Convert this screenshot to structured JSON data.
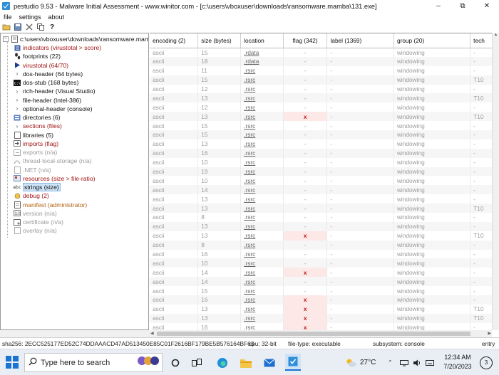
{
  "window": {
    "title": "pestudio 9.53 - Malware Initial Assessment - www.winitor.com - [c:\\users\\vboxuser\\downloads\\ransomware.mamba\\131.exe]",
    "minimize": "–",
    "maximize": "⧉",
    "close": "✕"
  },
  "menu": [
    "file",
    "settings",
    "about"
  ],
  "toolbar": [
    "open-icon",
    "save-icon",
    "close-file-icon",
    "copy-icon",
    "help-icon"
  ],
  "tree": {
    "root": "c:\\users\\vboxuser\\downloads\\ransomware.mamb",
    "items": [
      {
        "label": "indicators (virustotal > score)",
        "color": "red",
        "icon": "indicators-icon"
      },
      {
        "label": "footprints (22)",
        "color": "",
        "icon": "footprints-icon"
      },
      {
        "label": "virustotal (64/70)",
        "color": "red",
        "icon": "virustotal-icon"
      },
      {
        "label": "dos-header (64 bytes)",
        "color": "",
        "icon": "chevron-icon"
      },
      {
        "label": "dos-stub (168 bytes)",
        "color": "",
        "icon": "dos-icon"
      },
      {
        "label": "rich-header (Visual Studio)",
        "color": "",
        "icon": "chevron-icon"
      },
      {
        "label": "file-header (Intel-386)",
        "color": "",
        "icon": "chevron-icon"
      },
      {
        "label": "optional-header (console)",
        "color": "",
        "icon": "chevron-icon"
      },
      {
        "label": "directories (6)",
        "color": "",
        "icon": "directories-icon"
      },
      {
        "label": "sections (files)",
        "color": "red",
        "icon": "chevron-icon"
      },
      {
        "label": "libraries (5)",
        "color": "",
        "icon": "libraries-icon"
      },
      {
        "label": "imports (flag)",
        "color": "red",
        "icon": "imports-icon"
      },
      {
        "label": "exports (n/a)",
        "color": "grey",
        "icon": "exports-icon"
      },
      {
        "label": "thread-local-storage (n/a)",
        "color": "grey",
        "icon": "tls-icon"
      },
      {
        "label": ".NET (n/a)",
        "color": "grey",
        "icon": "dotnet-icon"
      },
      {
        "label": "resources (size > file-ratio)",
        "color": "red",
        "icon": "resources-icon"
      },
      {
        "label": "strings (size)",
        "color": "",
        "icon": "strings-icon",
        "selected": true
      },
      {
        "label": "debug (2)",
        "color": "red",
        "icon": "debug-icon"
      },
      {
        "label": "manifest (administrator)",
        "color": "orange",
        "icon": "manifest-icon"
      },
      {
        "label": "version (n/a)",
        "color": "grey",
        "icon": "version-icon"
      },
      {
        "label": "certificate (n/a)",
        "color": "grey",
        "icon": "certificate-icon"
      },
      {
        "label": "overlay (n/a)",
        "color": "grey",
        "icon": "overlay-icon"
      }
    ]
  },
  "grid": {
    "columns": [
      "encoding (2)",
      "size (bytes)",
      "location",
      "flag (342)",
      "label (1369)",
      "group (20)",
      "tech"
    ],
    "rows": [
      [
        "ascii",
        "15",
        ".rdata",
        "-",
        "-",
        "windowing",
        "-"
      ],
      [
        "ascii",
        "18",
        ".rdata",
        "-",
        "-",
        "windowing",
        "-"
      ],
      [
        "ascii",
        "11",
        ".rsrc",
        "-",
        "-",
        "windowing",
        "-"
      ],
      [
        "ascii",
        "15",
        ".rsrc",
        "-",
        "-",
        "windowing",
        "T10"
      ],
      [
        "ascii",
        "12",
        ".rsrc",
        "-",
        "-",
        "windowing",
        "-"
      ],
      [
        "ascii",
        "13",
        ".rsrc",
        "-",
        "-",
        "windowing",
        "T10"
      ],
      [
        "ascii",
        "12",
        ".rsrc",
        "-",
        "-",
        "windowing",
        "-"
      ],
      [
        "ascii",
        "13",
        ".rsrc",
        "x",
        "-",
        "windowing",
        "T10"
      ],
      [
        "ascii",
        "15",
        ".rsrc",
        "-",
        "-",
        "windowing",
        "-"
      ],
      [
        "ascii",
        "15",
        ".rsrc",
        "-",
        "-",
        "windowing",
        "-"
      ],
      [
        "ascii",
        "13",
        ".rsrc",
        "-",
        "-",
        "windowing",
        "-"
      ],
      [
        "ascii",
        "16",
        ".rsrc",
        "-",
        "-",
        "windowing",
        "-"
      ],
      [
        "ascii",
        "10",
        ".rsrc",
        "-",
        "-",
        "windowing",
        "-"
      ],
      [
        "ascii",
        "19",
        ".rsrc",
        "-",
        "-",
        "windowing",
        "-"
      ],
      [
        "ascii",
        "10",
        ".rsrc",
        "-",
        "-",
        "windowing",
        "-"
      ],
      [
        "ascii",
        "14",
        ".rsrc",
        "-",
        "-",
        "windowing",
        "-"
      ],
      [
        "ascii",
        "13",
        ".rsrc",
        "-",
        "-",
        "windowing",
        "-"
      ],
      [
        "ascii",
        "13",
        ".rsrc",
        "-",
        "-",
        "windowing",
        "T10"
      ],
      [
        "ascii",
        "8",
        ".rsrc",
        "-",
        "-",
        "windowing",
        "-"
      ],
      [
        "ascii",
        "13",
        ".rsrc",
        "-",
        "-",
        "windowing",
        "-"
      ],
      [
        "ascii",
        "13",
        ".rsrc",
        "x",
        "-",
        "windowing",
        "T10"
      ],
      [
        "ascii",
        "8",
        ".rsrc",
        "-",
        "-",
        "windowing",
        "-"
      ],
      [
        "ascii",
        "16",
        ".rsrc",
        "-",
        "-",
        "windowing",
        "-"
      ],
      [
        "ascii",
        "10",
        ".rsrc",
        "-",
        "-",
        "windowing",
        "-"
      ],
      [
        "ascii",
        "14",
        ".rsrc",
        "x",
        "-",
        "windowing",
        "-"
      ],
      [
        "ascii",
        "14",
        ".rsrc",
        "-",
        "-",
        "windowing",
        "-"
      ],
      [
        "ascii",
        "15",
        ".rsrc",
        "-",
        "-",
        "windowing",
        "-"
      ],
      [
        "ascii",
        "16",
        ".rsrc",
        "x",
        "-",
        "windowing",
        "-"
      ],
      [
        "ascii",
        "13",
        ".rsrc",
        "x",
        "-",
        "windowing",
        "T10"
      ],
      [
        "ascii",
        "13",
        ".rsrc",
        "x",
        "-",
        "windowing",
        "T10"
      ],
      [
        "ascii",
        "16",
        ".rsrc",
        "x",
        "-",
        "windowing",
        "-"
      ]
    ]
  },
  "status": {
    "sha256": "sha256: 2ECC525177ED52C74DDAAACD47AD513450E85C01F2616BF179BE5B576164BF63",
    "cpu": "cpu: 32-bit",
    "filetype": "file-type: executable",
    "subsystem": "subsystem: console",
    "entry": "entry"
  },
  "taskbar": {
    "search_placeholder": "Type here to search",
    "temperature": "27°C",
    "time": "12:34 AM",
    "date": "7/20/2023",
    "notifications": "3"
  }
}
